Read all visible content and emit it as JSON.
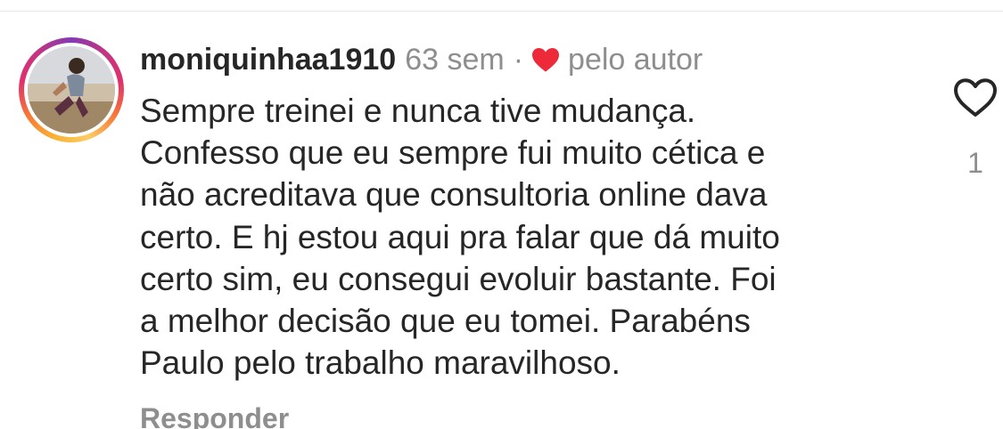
{
  "comment": {
    "username": "moniquinhaa1910",
    "time": "63 sem",
    "separator": "·",
    "author_like_label": "pelo autor",
    "lines": [
      "Sempre treinei e nunca tive mudança.",
      "Confesso que eu sempre fui muito cética e",
      "não acreditava que consultoria online dava",
      "certo. E hj estou aqui pra falar que dá muito",
      "certo sim, eu consegui evoluir bastante. Foi",
      "a melhor decisão que eu tomei. Parabéns",
      "Paulo pelo trabalho maravilhoso."
    ],
    "reply_label": "Responder",
    "like_count": "1"
  },
  "icons": {
    "author_heart": "heart-filled-icon",
    "like": "heart-outline-icon"
  },
  "colors": {
    "text_primary": "#262626",
    "text_secondary": "#8e8e8e",
    "heart_red": "#ed4956",
    "divider": "#e6e6e6"
  }
}
